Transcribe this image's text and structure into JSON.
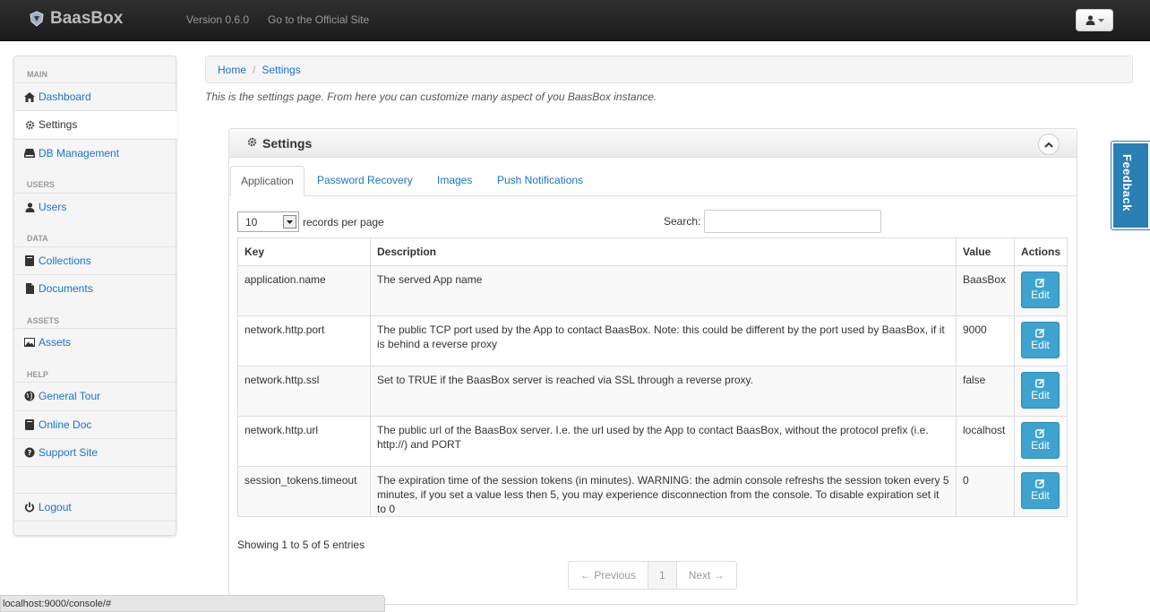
{
  "navbar": {
    "brand": "BaasBox",
    "version": "Version 0.6.0",
    "official_site": "Go to the Official Site"
  },
  "sidebar": {
    "sections": {
      "main": "MAIN",
      "users": "USERS",
      "data": "DATA",
      "assets": "ASSETS",
      "help": "HELP"
    },
    "items": {
      "dashboard": "Dashboard",
      "settings": "Settings",
      "db_management": "DB Management",
      "users": "Users",
      "collections": "Collections",
      "documents": "Documents",
      "assets": "Assets",
      "general_tour": "General Tour",
      "online_doc": "Online Doc",
      "support_site": "Support Site",
      "logout": "Logout"
    },
    "active": "Settings"
  },
  "breadcrumb": {
    "home": "Home",
    "separator": "/",
    "current": "Settings"
  },
  "intro": "This is the settings page. From here you can customize many aspect of you BaasBox instance.",
  "panel": {
    "title": "Settings",
    "tabs": [
      "Application",
      "Password Recovery",
      "Images",
      "Push Notifications"
    ],
    "active_tab": "Application",
    "records": {
      "value": "10",
      "label": "records per page"
    },
    "search_label": "Search:",
    "columns": [
      "Key",
      "Description",
      "Value",
      "Actions"
    ],
    "rows": [
      {
        "key": "application.name",
        "description": "The served App name",
        "value": "BaasBox",
        "action": "Edit"
      },
      {
        "key": "network.http.port",
        "description": "The public TCP port used by the App to contact BaasBox. Note: this could be different by the port used by BaasBox, if it is behind a reverse proxy",
        "value": "9000",
        "action": "Edit"
      },
      {
        "key": "network.http.ssl",
        "description": "Set to TRUE if the BaasBox server is reached via SSL through a reverse proxy.",
        "value": "false",
        "action": "Edit"
      },
      {
        "key": "network.http.url",
        "description": "The public url of the BaasBox server. I.e. the url used by the App to contact BaasBox, without the protocol prefix (i.e. http://) and PORT",
        "value": "localhost",
        "action": "Edit"
      },
      {
        "key": "session_tokens.timeout",
        "description": "The expiration time of the session tokens (in minutes). WARNING: the admin console refreshs the session token every 5 minutes, if you set a value less then 5, you may experience disconnection from the console. To disable expiration set it to 0",
        "value": "0",
        "action": "Edit"
      }
    ],
    "info": "Showing 1 to 5 of 5 entries",
    "pagination": {
      "previous": "← Previous",
      "page": "1",
      "next": "Next →"
    }
  },
  "feedback": "Feedback",
  "status_url": "localhost:9000/console/#",
  "colors": {
    "link": "#1a73c8",
    "navbar": "#222222",
    "edit_button": "#3fa3d0",
    "feedback_tab": "#2a7fb5"
  }
}
